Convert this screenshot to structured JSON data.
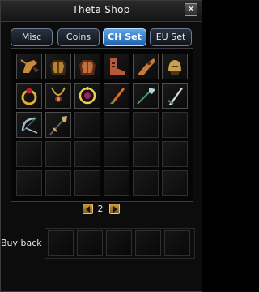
{
  "window": {
    "title": "Theta Shop",
    "close_glyph": "✕"
  },
  "tabs": [
    {
      "label": "Misc",
      "active": false
    },
    {
      "label": "Coins",
      "active": false
    },
    {
      "label": "CH Set",
      "active": true
    },
    {
      "label": "EU Set",
      "active": false
    }
  ],
  "grid": {
    "rows": 5,
    "cols": 6,
    "items": [
      {
        "icon": "gauntlet-claw-icon",
        "colors": [
          "#c8893a",
          "#5a3a1a"
        ]
      },
      {
        "icon": "armor-icon",
        "colors": [
          "#b8832e",
          "#3a2a14"
        ]
      },
      {
        "icon": "armor-icon",
        "colors": [
          "#c0703a",
          "#5a2a1a"
        ]
      },
      {
        "icon": "boots-icon",
        "colors": [
          "#b85a3a",
          "#3a1a14"
        ]
      },
      {
        "icon": "gauntlet-icon",
        "colors": [
          "#c87a3a",
          "#4a2a14"
        ]
      },
      {
        "icon": "helmet-icon",
        "colors": [
          "#c8a050",
          "#4a3a1a"
        ]
      },
      {
        "icon": "ring-icon",
        "colors": [
          "#e0b030",
          "#c02030"
        ]
      },
      {
        "icon": "necklace-icon",
        "colors": [
          "#d0a040",
          "#8a3020"
        ]
      },
      {
        "icon": "earring-icon",
        "colors": [
          "#f0d050",
          "#a02060"
        ]
      },
      {
        "icon": "blade-icon",
        "colors": [
          "#e06a20",
          "#3aa040"
        ]
      },
      {
        "icon": "glaive-icon",
        "colors": [
          "#c0d0e0",
          "#40a060"
        ]
      },
      {
        "icon": "sword-icon",
        "colors": [
          "#d0d8e0",
          "#608060"
        ]
      },
      {
        "icon": "bow-icon",
        "colors": [
          "#a0c0d0",
          "#408090"
        ]
      },
      {
        "icon": "spear-icon",
        "colors": [
          "#d0b070",
          "#606060"
        ]
      }
    ]
  },
  "pager": {
    "page": "2",
    "prev_icon": "left-arrow-icon",
    "next_icon": "right-arrow-icon"
  },
  "buyback": {
    "label": "Buy back",
    "slots": 5
  }
}
